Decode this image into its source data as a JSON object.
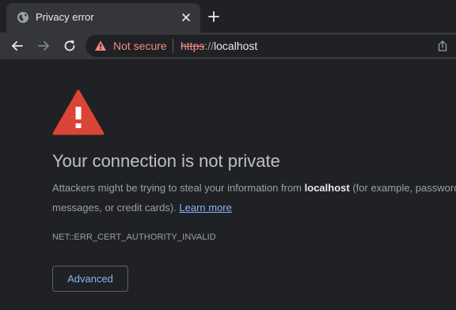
{
  "tab": {
    "title": "Privacy error",
    "favicon": "globe-icon"
  },
  "toolbar": {
    "security_label": "Not secure",
    "url_scheme": "https",
    "url_separator": "://",
    "url_host": "localhost"
  },
  "interstitial": {
    "heading": "Your connection is not private",
    "desc_part1": "Attackers might be trying to steal your information from ",
    "desc_host": "localhost",
    "desc_part2": " (for example, passwords, messages, or credit cards). ",
    "learn_more": "Learn more",
    "error_code": "NET::ERR_CERT_AUTHORITY_INVALID",
    "advanced_label": "Advanced"
  },
  "colors": {
    "background": "#202124",
    "warning_red": "#db4437",
    "link_blue": "#8ab4f8",
    "not_secure_red": "#f28b82"
  }
}
